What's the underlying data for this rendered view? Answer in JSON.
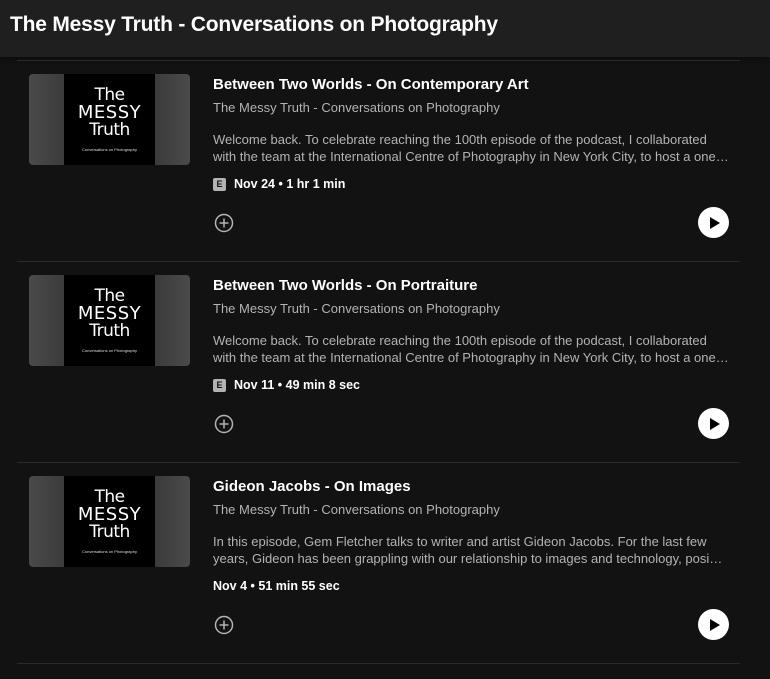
{
  "header": {
    "title": "The Messy Truth - Conversations on Photography"
  },
  "cover": {
    "line1": "The",
    "line2": "MESSY",
    "line3": "Truth",
    "subtitle": "Conversations on Photography"
  },
  "episodes": [
    {
      "title": "Between Two Worlds - On Contemporary Art",
      "show": "The Messy Truth - Conversations on Photography",
      "desc_line1": "Welcome back. To celebrate reaching the 100th episode of the podcast, I collaborated",
      "desc_line2": "with the team at the International Centre of Photography in New York City, to host a one…",
      "explicit": "E",
      "meta": "Nov 24 • 1 hr 1 min"
    },
    {
      "title": "Between Two Worlds - On Portraiture",
      "show": "The Messy Truth - Conversations on Photography",
      "desc_line1": "Welcome back. To celebrate reaching the 100th episode of the podcast, I collaborated",
      "desc_line2": "with the team at the International Centre of Photography in New York City, to host a one…",
      "explicit": "E",
      "meta": "Nov 11 • 49 min 8 sec"
    },
    {
      "title": "Gideon Jacobs - On Images",
      "show": "The Messy Truth - Conversations on Photography",
      "desc_line1": "In this episode, Gem Fletcher talks to writer and artist Gideon Jacobs. For the last few",
      "desc_line2": "years, Gideon has been grappling with our relationship to images and technology, posi…",
      "explicit": "",
      "meta": "Nov 4 • 51 min 55 sec"
    }
  ],
  "icons": {
    "add": "add-circle-icon",
    "play": "play-icon"
  }
}
